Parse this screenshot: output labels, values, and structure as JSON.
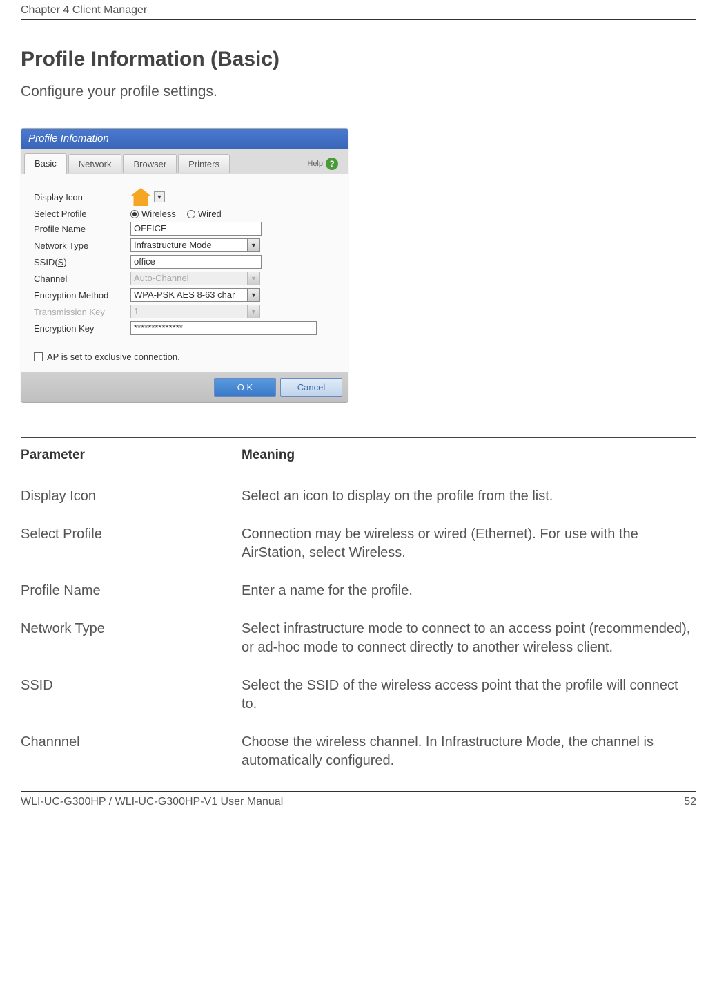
{
  "header": {
    "chapter": "Chapter 4  Client Manager"
  },
  "section": {
    "title": "Profile Information (Basic)",
    "subtitle": "Configure your profile settings."
  },
  "dialog": {
    "title": "Profile Infomation",
    "tabs": {
      "basic": "Basic",
      "network": "Network",
      "browser": "Browser",
      "printers": "Printers"
    },
    "help_label": "Help",
    "labels": {
      "display_icon": "Display Icon",
      "select_profile": "Select Profile",
      "profile_name": "Profile Name",
      "network_type": "Network Type",
      "ssid": "SSID(",
      "ssid_s": "S",
      "ssid_close": ")",
      "channel": "Channel",
      "encryption_method": "Encryption Method",
      "transmission_key": "Transmission Key",
      "encryption_key": "Encryption Key"
    },
    "radio": {
      "wireless": "Wireless",
      "wired": "Wired"
    },
    "values": {
      "profile_name": "OFFICE",
      "network_type": "Infrastructure Mode",
      "ssid": "office",
      "channel": "Auto-Channel",
      "encryption_method": "WPA-PSK AES 8-63 char",
      "transmission_key": "1",
      "encryption_key": "**************"
    },
    "checkbox_label": "AP is set to exclusive connection.",
    "buttons": {
      "ok": "O K",
      "cancel": "Cancel"
    }
  },
  "table": {
    "header_param": "Parameter",
    "header_meaning": "Meaning",
    "rows": [
      {
        "param": "Display Icon",
        "meaning": "Select an icon to display on the profile from the list."
      },
      {
        "param": "Select Profile",
        "meaning": "Connection may be wireless or wired (Ethernet). For use with the AirStation, select Wireless."
      },
      {
        "param": "Profile Name",
        "meaning": "Enter a name for the profile."
      },
      {
        "param": "Network Type",
        "meaning": "Select infrastructure mode to connect to an access point (recommended), or ad-hoc mode to connect directly to another wireless client."
      },
      {
        "param": "SSID",
        "meaning": "Select the SSID of the wireless access point that the profile will connect to."
      },
      {
        "param": "Channnel",
        "meaning": "Choose the wireless channel. In Infrastructure Mode, the channel is automatically configured."
      }
    ]
  },
  "footer": {
    "manual": "WLI-UC-G300HP / WLI-UC-G300HP-V1 User Manual",
    "page": "52"
  }
}
